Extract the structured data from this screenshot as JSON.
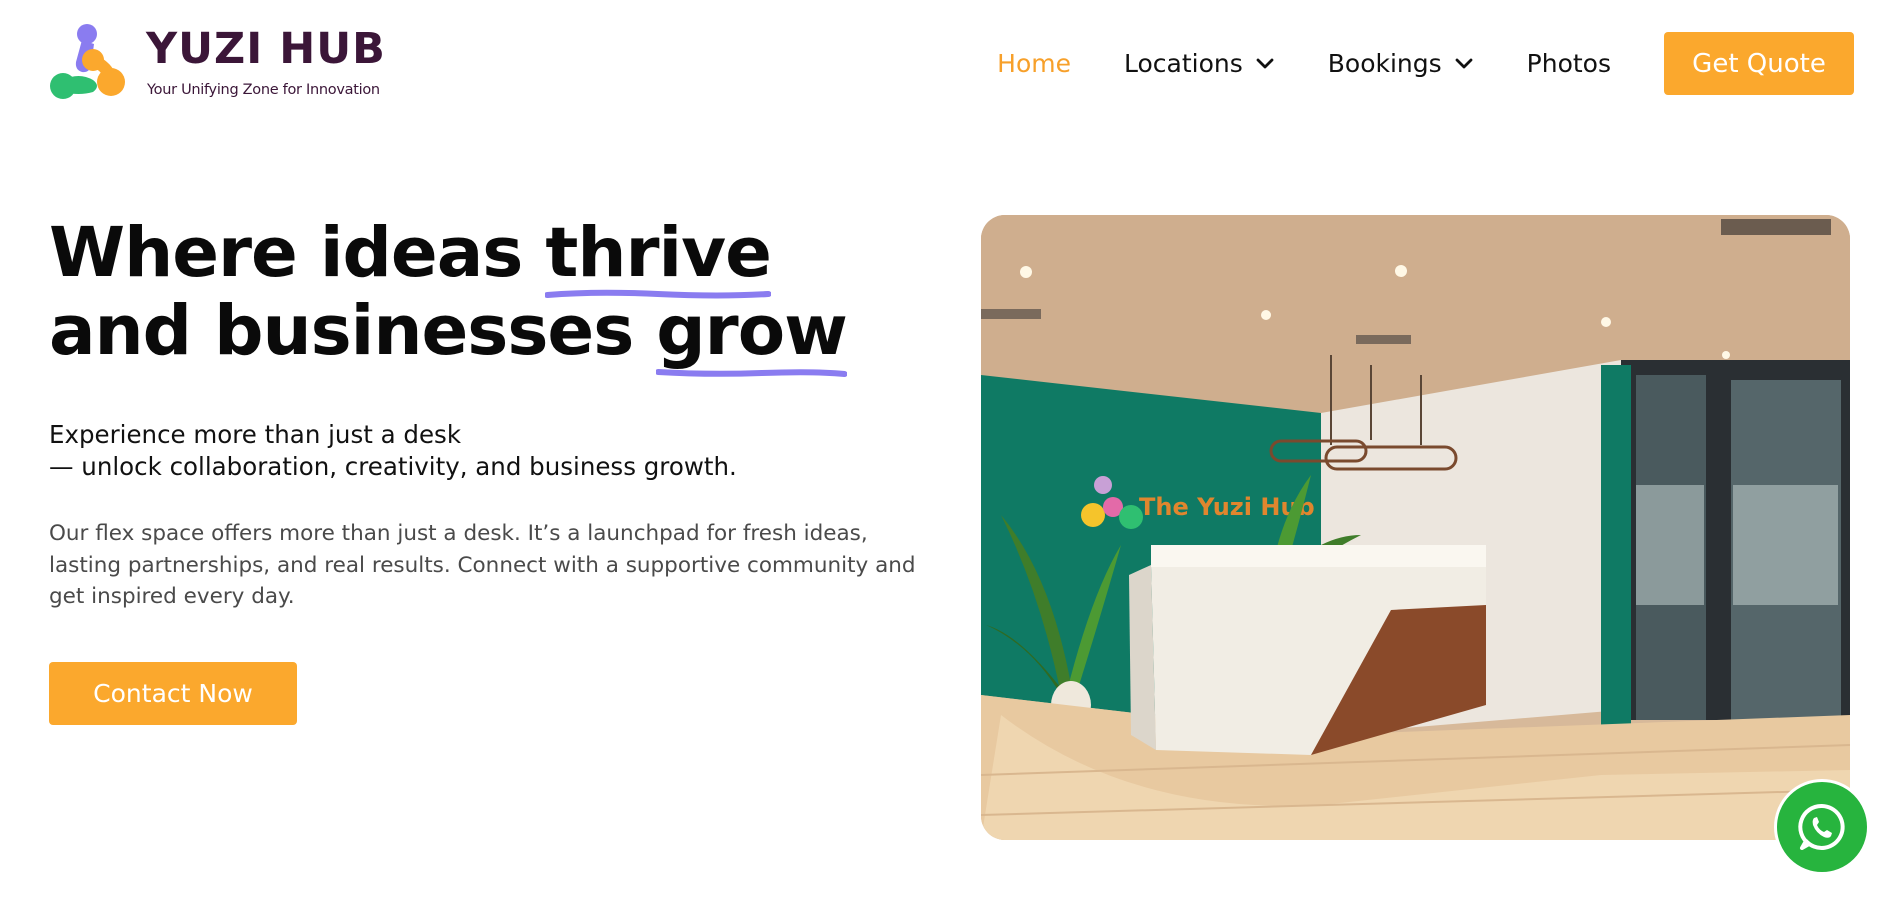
{
  "brand": {
    "name": "YUZI HUB",
    "tagline": "Your Unifying Zone for Innovation",
    "colors": {
      "primary": "#3b1638",
      "accent": "#fba82d",
      "purple": "#8a7cf0",
      "green": "#2fbf71"
    }
  },
  "nav": {
    "items": [
      {
        "label": "Home",
        "active": true,
        "dropdown": false
      },
      {
        "label": "Locations",
        "active": false,
        "dropdown": true,
        "icon": "chevron-down-icon"
      },
      {
        "label": "Bookings",
        "active": false,
        "dropdown": true,
        "icon": "chevron-down-icon"
      },
      {
        "label": "Photos",
        "active": false,
        "dropdown": false
      }
    ],
    "cta_label": "Get Quote"
  },
  "hero": {
    "headline": {
      "line1_prefix": "Where ideas ",
      "line1_highlight": "thrive",
      "line2_prefix": "and businesses ",
      "line2_highlight": "grow"
    },
    "lead_line1": "Experience more than just a desk",
    "lead_line2": "— unlock collaboration, creativity, and business growth.",
    "body": "Our flex space offers more than just a desk. It’s a launchpad for fresh ideas, lasting partnerships, and real results. Connect with a supportive community and get inspired every day.",
    "cta_label": "Contact Now",
    "image_sign_text": "The Yuzi Hub"
  },
  "floating": {
    "whatsapp_icon": "whatsapp-icon",
    "color": "#27b43e"
  }
}
